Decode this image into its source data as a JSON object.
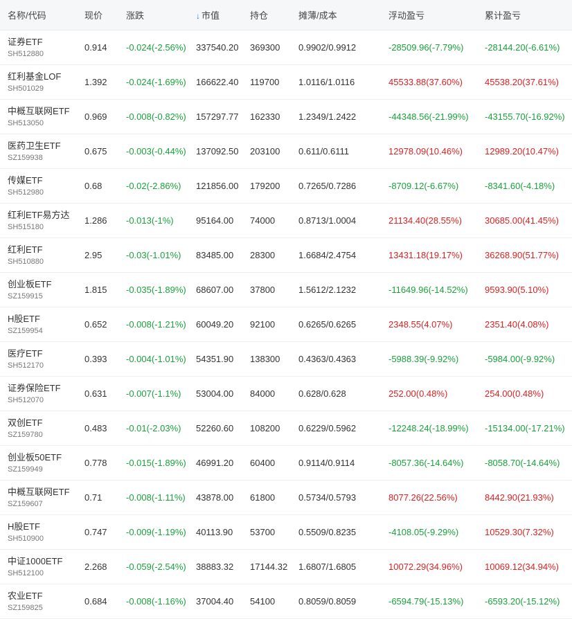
{
  "headers": {
    "name": "名称/代码",
    "price": "现价",
    "change": "涨跌",
    "sort_arrow": "↓",
    "market_value": "市值",
    "position": "持仓",
    "cost": "摊薄/成本",
    "float_pnl": "浮动盈亏",
    "total_pnl": "累计盈亏"
  },
  "colors": {
    "loss": "#17a33a",
    "gain": "#e02020"
  },
  "rows": [
    {
      "name": "证券ETF",
      "code": "SH512880",
      "price": "0.914",
      "change": "-0.024(-2.56%)",
      "value": "337540.20",
      "pos": "369300",
      "cost": "0.9902/0.9912",
      "fpnl": "-28509.96(-7.79%)",
      "fdir": "g",
      "tpnl": "-28144.20(-6.61%)",
      "tdir": "g"
    },
    {
      "name": "红利基金LOF",
      "code": "SH501029",
      "price": "1.392",
      "change": "-0.024(-1.69%)",
      "value": "166622.40",
      "pos": "119700",
      "cost": "1.0116/1.0116",
      "fpnl": "45533.88(37.60%)",
      "fdir": "r",
      "tpnl": "45538.20(37.61%)",
      "tdir": "r"
    },
    {
      "name": "中概互联网ETF",
      "code": "SH513050",
      "price": "0.969",
      "change": "-0.008(-0.82%)",
      "value": "157297.77",
      "pos": "162330",
      "cost": "1.2349/1.2422",
      "fpnl": "-44348.56(-21.99%)",
      "fdir": "g",
      "tpnl": "-43155.70(-16.92%)",
      "tdir": "g"
    },
    {
      "name": "医药卫生ETF",
      "code": "SZ159938",
      "price": "0.675",
      "change": "-0.003(-0.44%)",
      "value": "137092.50",
      "pos": "203100",
      "cost": "0.611/0.6111",
      "fpnl": "12978.09(10.46%)",
      "fdir": "r",
      "tpnl": "12989.20(10.47%)",
      "tdir": "r"
    },
    {
      "name": "传媒ETF",
      "code": "SH512980",
      "price": "0.68",
      "change": "-0.02(-2.86%)",
      "value": "121856.00",
      "pos": "179200",
      "cost": "0.7265/0.7286",
      "fpnl": "-8709.12(-6.67%)",
      "fdir": "g",
      "tpnl": "-8341.60(-4.18%)",
      "tdir": "g"
    },
    {
      "name": "红利ETF易方达",
      "code": "SH515180",
      "price": "1.286",
      "change": "-0.013(-1%)",
      "value": "95164.00",
      "pos": "74000",
      "cost": "0.8713/1.0004",
      "fpnl": "21134.40(28.55%)",
      "fdir": "r",
      "tpnl": "30685.00(41.45%)",
      "tdir": "r"
    },
    {
      "name": "红利ETF",
      "code": "SH510880",
      "price": "2.95",
      "change": "-0.03(-1.01%)",
      "value": "83485.00",
      "pos": "28300",
      "cost": "1.6684/2.4754",
      "fpnl": "13431.18(19.17%)",
      "fdir": "r",
      "tpnl": "36268.90(51.77%)",
      "tdir": "r"
    },
    {
      "name": "创业板ETF",
      "code": "SZ159915",
      "price": "1.815",
      "change": "-0.035(-1.89%)",
      "value": "68607.00",
      "pos": "37800",
      "cost": "1.5612/2.1232",
      "fpnl": "-11649.96(-14.52%)",
      "fdir": "g",
      "tpnl": "9593.90(5.10%)",
      "tdir": "r"
    },
    {
      "name": "H股ETF",
      "code": "SZ159954",
      "price": "0.652",
      "change": "-0.008(-1.21%)",
      "value": "60049.20",
      "pos": "92100",
      "cost": "0.6265/0.6265",
      "fpnl": "2348.55(4.07%)",
      "fdir": "r",
      "tpnl": "2351.40(4.08%)",
      "tdir": "r"
    },
    {
      "name": "医疗ETF",
      "code": "SH512170",
      "price": "0.393",
      "change": "-0.004(-1.01%)",
      "value": "54351.90",
      "pos": "138300",
      "cost": "0.4363/0.4363",
      "fpnl": "-5988.39(-9.92%)",
      "fdir": "g",
      "tpnl": "-5984.00(-9.92%)",
      "tdir": "g"
    },
    {
      "name": "证券保险ETF",
      "code": "SH512070",
      "price": "0.631",
      "change": "-0.007(-1.1%)",
      "value": "53004.00",
      "pos": "84000",
      "cost": "0.628/0.628",
      "fpnl": "252.00(0.48%)",
      "fdir": "r",
      "tpnl": "254.00(0.48%)",
      "tdir": "r"
    },
    {
      "name": "双创ETF",
      "code": "SZ159780",
      "price": "0.483",
      "change": "-0.01(-2.03%)",
      "value": "52260.60",
      "pos": "108200",
      "cost": "0.6229/0.5962",
      "fpnl": "-12248.24(-18.99%)",
      "fdir": "g",
      "tpnl": "-15134.00(-17.21%)",
      "tdir": "g"
    },
    {
      "name": "创业板50ETF",
      "code": "SZ159949",
      "price": "0.778",
      "change": "-0.015(-1.89%)",
      "value": "46991.20",
      "pos": "60400",
      "cost": "0.9114/0.9114",
      "fpnl": "-8057.36(-14.64%)",
      "fdir": "g",
      "tpnl": "-8058.70(-14.64%)",
      "tdir": "g"
    },
    {
      "name": "中概互联网ETF",
      "code": "SZ159607",
      "price": "0.71",
      "change": "-0.008(-1.11%)",
      "value": "43878.00",
      "pos": "61800",
      "cost": "0.5734/0.5793",
      "fpnl": "8077.26(22.56%)",
      "fdir": "r",
      "tpnl": "8442.90(21.93%)",
      "tdir": "r"
    },
    {
      "name": "H股ETF",
      "code": "SH510900",
      "price": "0.747",
      "change": "-0.009(-1.19%)",
      "value": "40113.90",
      "pos": "53700",
      "cost": "0.5509/0.8235",
      "fpnl": "-4108.05(-9.29%)",
      "fdir": "g",
      "tpnl": "10529.30(7.32%)",
      "tdir": "r"
    },
    {
      "name": "中证1000ETF",
      "code": "SH512100",
      "price": "2.268",
      "change": "-0.059(-2.54%)",
      "value": "38883.32",
      "pos": "17144.32",
      "cost": "1.6807/1.6805",
      "fpnl": "10072.29(34.96%)",
      "fdir": "r",
      "tpnl": "10069.12(34.94%)",
      "tdir": "r"
    },
    {
      "name": "农业ETF",
      "code": "SZ159825",
      "price": "0.684",
      "change": "-0.008(-1.16%)",
      "value": "37004.40",
      "pos": "54100",
      "cost": "0.8059/0.8059",
      "fpnl": "-6594.79(-15.13%)",
      "fdir": "g",
      "tpnl": "-6593.20(-15.12%)",
      "tdir": "g"
    }
  ]
}
